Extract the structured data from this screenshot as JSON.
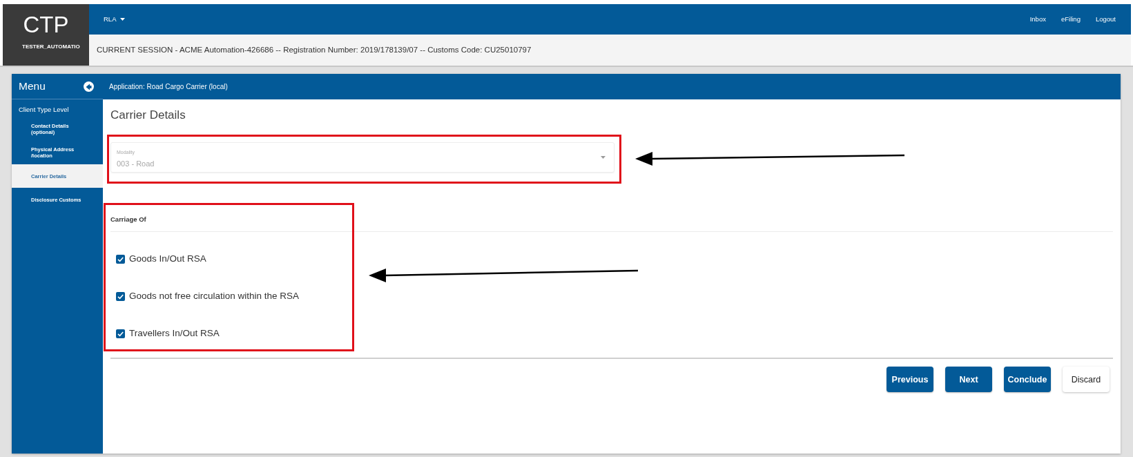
{
  "header": {
    "logo": "CTP",
    "username": "TESTER_AUTOMATIO",
    "menu": {
      "label": "RLA"
    },
    "links": [
      "Inbox",
      "eFiling",
      "Logout"
    ],
    "session": "CURRENT SESSION - ACME Automation-426686 -- Registration Number: 2019/178139/07 -- Customs Code: CU25010797"
  },
  "sidebar": {
    "title": "Menu",
    "items": [
      {
        "label": "Client Type Level",
        "selected": false,
        "children": [
          {
            "label": "Contact Details (optional)",
            "selected": false
          },
          {
            "label": "Physical Address /location",
            "selected": false
          },
          {
            "label": "Carrier Details",
            "selected": true
          },
          {
            "label": "Disclosure Customs",
            "selected": false
          }
        ]
      }
    ]
  },
  "application_bar": {
    "title": "Application: Road Cargo Carrier (local)"
  },
  "form": {
    "title": "Carrier Details",
    "modality": {
      "label": "Modality",
      "value": "003 - Road"
    },
    "carriage": {
      "title": "Carriage Of",
      "options": [
        {
          "label": "Goods In/Out RSA",
          "checked": true
        },
        {
          "label": "Goods not free circulation within the RSA",
          "checked": true
        },
        {
          "label": "Travellers In/Out RSA",
          "checked": true
        }
      ]
    }
  },
  "buttons": [
    {
      "label": "Previous",
      "kind": "primary"
    },
    {
      "label": "Next",
      "kind": "primary"
    },
    {
      "label": "Conclude",
      "kind": "primary"
    },
    {
      "label": "Discard",
      "kind": "secondary"
    }
  ]
}
